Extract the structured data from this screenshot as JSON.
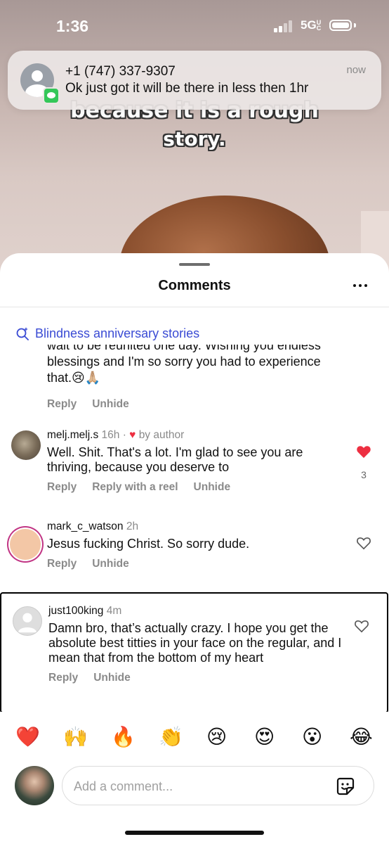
{
  "status_bar": {
    "time": "1:36",
    "network": "5G",
    "network_suffix": "UC"
  },
  "notification": {
    "title": "+1 (747) 337-9307",
    "message": "Ok just got it will be there in less then 1hr",
    "time": "now"
  },
  "video": {
    "caption_line1": "because it is a rough",
    "caption_line2": "story."
  },
  "sheet": {
    "title": "Comments"
  },
  "related_search": {
    "label": "Blindness anniversary stories",
    "icon": "sparkle-search-icon"
  },
  "first_comment": {
    "text_line1": "wait to be reunited one day. Wishing you endless",
    "text_line2": "blessings and I'm so sorry you had to experience",
    "text_line3": "that.😢🙏🏼",
    "reply": "Reply",
    "unhide": "Unhide"
  },
  "comments": [
    {
      "username": "melj.melj.s",
      "time": "16h",
      "author_like": "by author",
      "text": "Well. Shit. That's a lot. I'm glad to see you are thriving, because you deserve to",
      "reply": "Reply",
      "reply_reel": "Reply with a reel",
      "unhide": "Unhide",
      "likes": "3",
      "liked": true
    },
    {
      "username": "mark_c_watson",
      "time": "2h",
      "text": "Jesus fucking Christ. So sorry dude.",
      "reply": "Reply",
      "unhide": "Unhide",
      "liked": false
    },
    {
      "username": "just100king",
      "time": "4m",
      "text": "Damn bro, that’s actually crazy. I hope you get the absolute best titties in your face on the regular, and I mean that from the bottom of my heart",
      "reply": "Reply",
      "unhide": "Unhide",
      "liked": false
    }
  ],
  "emoji_bar": [
    "❤️",
    "🙌",
    "🔥",
    "👏",
    "😢",
    "😍",
    "😮",
    "😂"
  ],
  "input": {
    "placeholder": "Add a comment..."
  },
  "colors": {
    "accent": "#3a4bd4",
    "like_red": "#ed2f41",
    "story_ring": "#c13584"
  }
}
